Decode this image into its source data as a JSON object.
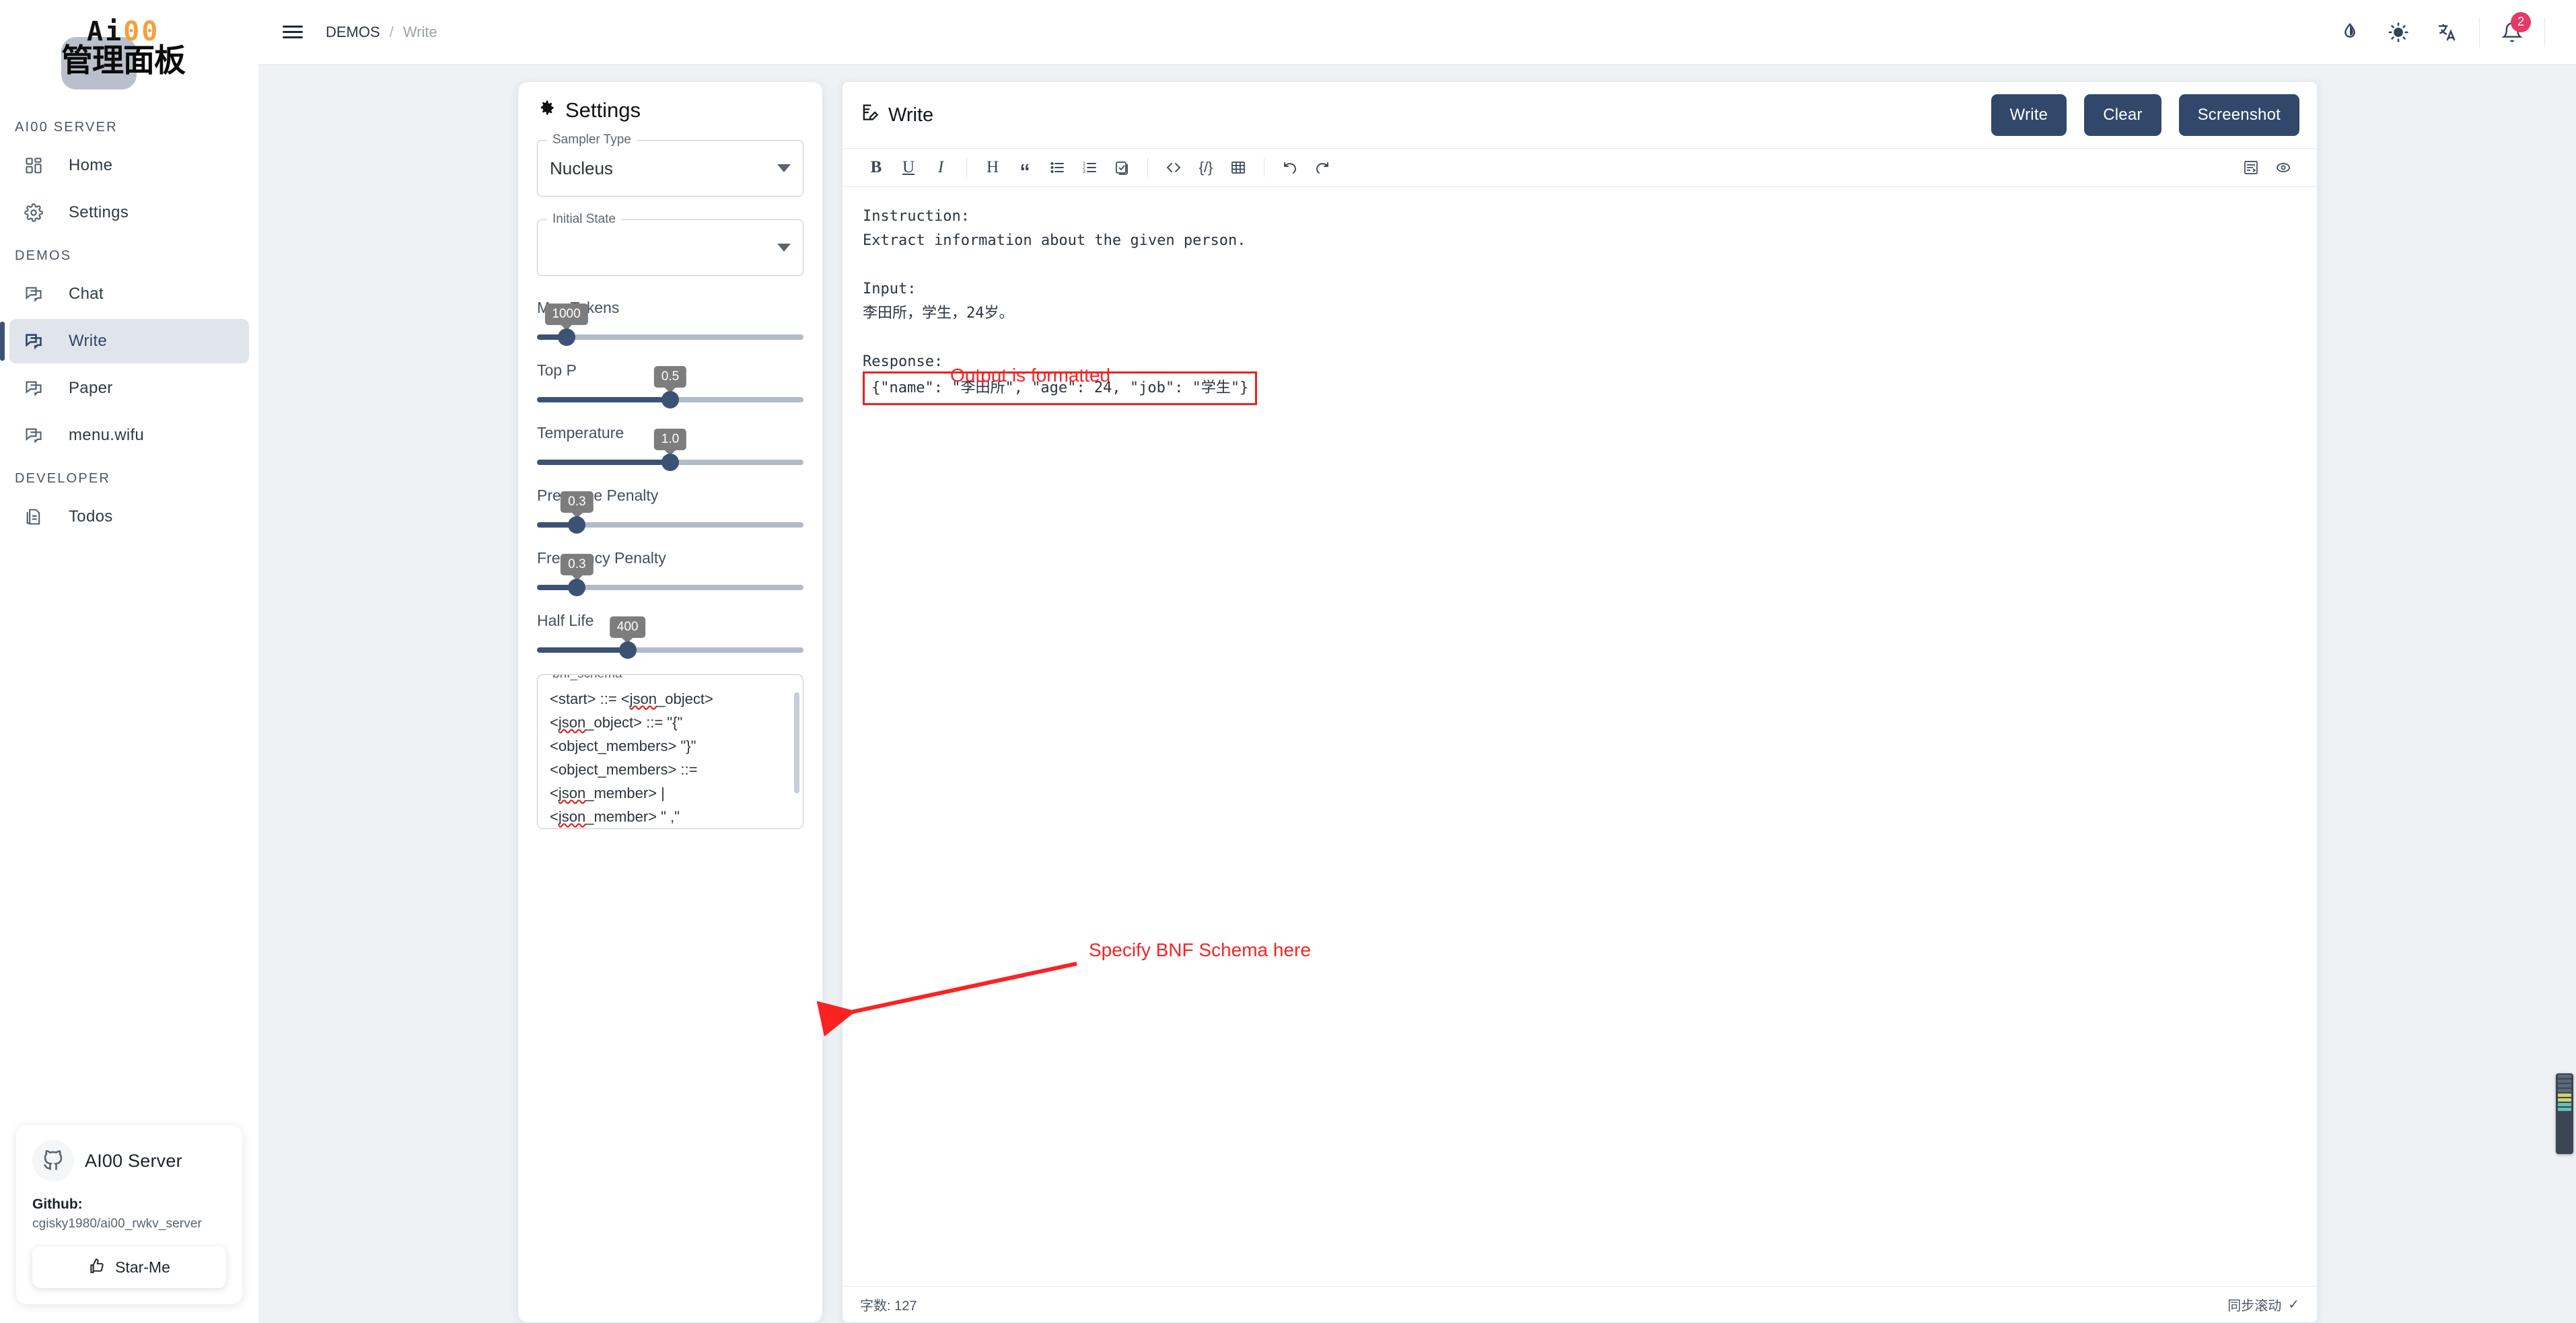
{
  "sidebar": {
    "logo": {
      "top_text_prefix": "Ai",
      "top_text_zeros": "00",
      "bottom_text": "管理面板"
    },
    "sections": [
      {
        "title": "AI00 SERVER",
        "items": [
          {
            "label": "Home",
            "icon": "dashboard-icon",
            "active": false
          },
          {
            "label": "Settings",
            "icon": "gear-icon",
            "active": false
          }
        ]
      },
      {
        "title": "DEMOS",
        "items": [
          {
            "label": "Chat",
            "icon": "chat-icon",
            "active": false
          },
          {
            "label": "Write",
            "icon": "chat-icon",
            "active": true
          },
          {
            "label": "Paper",
            "icon": "chat-icon",
            "active": false
          },
          {
            "label": "menu.wifu",
            "icon": "chat-icon",
            "active": false
          }
        ]
      },
      {
        "title": "DEVELOPER",
        "items": [
          {
            "label": "Todos",
            "icon": "document-icon",
            "active": false
          }
        ]
      }
    ],
    "github_card": {
      "title": "AI00 Server",
      "label": "Github:",
      "url": "cgisky1980/ai00_rwkv_server",
      "button": "Star-Me",
      "icon": "github-icon"
    }
  },
  "topbar": {
    "menu_icon": "hamburger-icon",
    "breadcrumb": {
      "parent": "DEMOS",
      "separator": "/",
      "current": "Write"
    },
    "icons": [
      {
        "name": "contrast-icon"
      },
      {
        "name": "brightness-icon"
      },
      {
        "name": "translate-icon"
      },
      {
        "name": "notification-bell-icon",
        "badge": "2"
      }
    ],
    "badge_color": "#e63963"
  },
  "settings": {
    "title": "Settings",
    "title_icon": "gear-icon",
    "sampler_type": {
      "label": "Sampler Type",
      "value": "Nucleus"
    },
    "initial_state": {
      "label": "Initial State",
      "value": ""
    },
    "sliders": [
      {
        "label": "Max Tokens",
        "value": "1000",
        "percent": 11
      },
      {
        "label": "Top P",
        "value": "0.5",
        "percent": 50
      },
      {
        "label": "Temperature",
        "value": "1.0",
        "percent": 50
      },
      {
        "label": "Presence Penalty",
        "value": "0.3",
        "percent": 15
      },
      {
        "label": "Frequency Penalty",
        "value": "0.3",
        "percent": 15
      },
      {
        "label": "Half Life",
        "value": "400",
        "percent": 34
      }
    ],
    "bnf": {
      "label": "bnf_schema",
      "lines": [
        "<start> ::= <json_object>",
        "<json_object> ::= \"{\"",
        "<object_members> \"}\"",
        "<object_members> ::=",
        "<json_member> |",
        "<json_member> \" ,\""
      ]
    },
    "accent_color": "#3c5275"
  },
  "write": {
    "title": "Write",
    "title_icon": "edit-document-icon",
    "buttons": [
      {
        "label": "Write",
        "name": "write-button"
      },
      {
        "label": "Clear",
        "name": "clear-button"
      },
      {
        "label": "Screenshot",
        "name": "screenshot-button"
      }
    ],
    "button_color": "#32486b",
    "toolbar": [
      {
        "name": "bold-icon",
        "glyph": "B"
      },
      {
        "name": "underline-icon",
        "glyph": "U"
      },
      {
        "name": "italic-icon",
        "glyph": "I"
      },
      {
        "name": "heading-icon",
        "glyph": "H"
      },
      {
        "name": "quote-icon",
        "glyph": "“"
      },
      {
        "name": "bullet-list-icon",
        "glyph": "☰"
      },
      {
        "name": "ordered-list-icon",
        "glyph": "☲"
      },
      {
        "name": "checklist-icon",
        "glyph": "☑"
      },
      {
        "name": "code-block-icon",
        "glyph": "‹›"
      },
      {
        "name": "inline-code-icon",
        "glyph": "{/}"
      },
      {
        "name": "table-icon",
        "glyph": "▦"
      },
      {
        "name": "undo-icon",
        "glyph": "↶"
      },
      {
        "name": "redo-icon",
        "glyph": "↷"
      }
    ],
    "toolbar_right": [
      {
        "name": "word-wrap-icon",
        "glyph": "≡"
      },
      {
        "name": "preview-eye-icon",
        "glyph": "◎"
      }
    ],
    "editor": {
      "lines": [
        "Instruction:",
        "Extract information about the given person.",
        "",
        "Input:",
        "李田所，学生，24岁。",
        "",
        "Response:"
      ],
      "highlighted_output": "{\"name\": \"李田所\", \"age\": 24, \"job\": \"学生\"}"
    },
    "footer": {
      "word_count": "字数: 127",
      "sync_scroll": "同步滚动",
      "sync_check": "✓"
    }
  },
  "annotations": {
    "output_note": "Output is formatted",
    "bnf_note": "Specify BNF Schema here",
    "color": "#fb2222"
  }
}
